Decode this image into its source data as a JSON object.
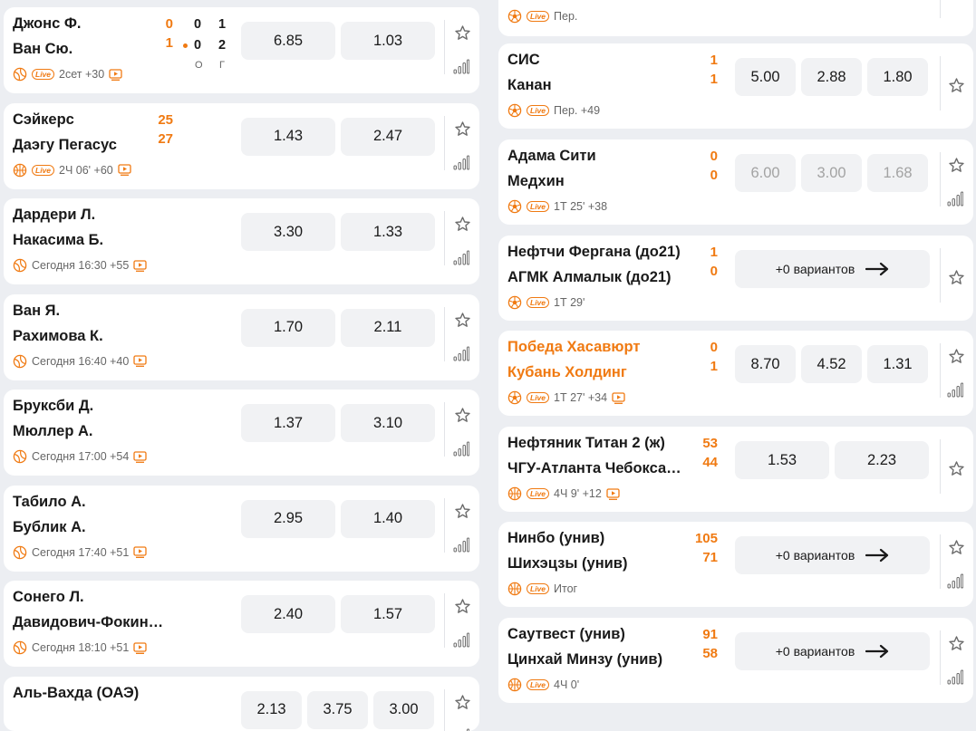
{
  "left_events": [
    {
      "team1": "Джонс Ф.",
      "team2": "Ван Сю.",
      "score1": "0",
      "score2": "1",
      "sport": "tennis",
      "live": "Live",
      "meta": "2сет +30",
      "tv": true,
      "set_scores": {
        "row1": [
          "0",
          "1"
        ],
        "row2": [
          "0",
          "2"
        ],
        "labels": [
          "О",
          "Г"
        ]
      },
      "odds": [
        "6.85",
        "1.03"
      ]
    },
    {
      "team1": "Сэйкерс",
      "team2": "Даэгу Пегасус",
      "score1": "25",
      "score2": "27",
      "sport": "basketball",
      "live": "Live",
      "meta": "2Ч 06' +60",
      "tv": true,
      "odds": [
        "1.43",
        "2.47"
      ]
    },
    {
      "team1": "Дардери Л.",
      "team2": "Накасима Б.",
      "sport": "tennis",
      "meta": "Сегодня 16:30 +55",
      "tv": true,
      "odds": [
        "3.30",
        "1.33"
      ]
    },
    {
      "team1": "Ван Я.",
      "team2": "Рахимова К.",
      "sport": "tennis",
      "meta": "Сегодня 16:40 +40",
      "tv": true,
      "odds": [
        "1.70",
        "2.11"
      ]
    },
    {
      "team1": "Бруксби Д.",
      "team2": "Мюллер А.",
      "sport": "tennis",
      "meta": "Сегодня 17:00 +54",
      "tv": true,
      "odds": [
        "1.37",
        "3.10"
      ]
    },
    {
      "team1": "Табило А.",
      "team2": "Бублик А.",
      "sport": "tennis",
      "meta": "Сегодня 17:40 +51",
      "tv": true,
      "odds": [
        "2.95",
        "1.40"
      ]
    },
    {
      "team1": "Сонего Л.",
      "team2": "Давидович-Фокина А.",
      "sport": "tennis",
      "meta": "Сегодня 18:10 +51",
      "tv": true,
      "odds": [
        "2.40",
        "1.57"
      ]
    },
    {
      "team1": "Аль-Вахда (ОАЭ)",
      "odds": [
        "2.13",
        "3.75",
        "3.00"
      ]
    }
  ],
  "right_events": [
    {
      "sport": "football",
      "live": "Live",
      "meta": "Пер."
    },
    {
      "team1": "СИС",
      "team2": "Канан",
      "score1": "1",
      "score2": "1",
      "sport": "football",
      "live": "Live",
      "meta": "Пер. +49",
      "odds": [
        "5.00",
        "2.88",
        "1.80"
      ]
    },
    {
      "team1": "Адама Сити",
      "team2": "Медхин",
      "score1": "0",
      "score2": "0",
      "sport": "football",
      "live": "Live",
      "meta": "1Т 25' +38",
      "odds": [
        "6.00",
        "3.00",
        "1.68"
      ],
      "dim": true
    },
    {
      "team1": "Нефтчи Фергана (до21)",
      "team2": "АГМК Алмалык (до21)",
      "score1": "1",
      "score2": "0",
      "sport": "football",
      "live": "Live",
      "meta": "1Т 29'",
      "more": "+0 вариантов"
    },
    {
      "team1": "Победа Хасавюрт",
      "team2": "Кубань Холдинг",
      "score1": "0",
      "score2": "1",
      "sport": "football",
      "live": "Live",
      "meta": "1Т 27' +34",
      "tv": true,
      "odds": [
        "8.70",
        "4.52",
        "1.31"
      ],
      "highlight": true
    },
    {
      "team1": "Нефтяник Титан 2 (ж)",
      "team2": "ЧГУ-Атланта Чебоксары (ж)",
      "score1": "53",
      "score2": "44",
      "sport": "basketball",
      "live": "Live",
      "meta": "4Ч 9' +12",
      "tv": true,
      "odds": [
        "1.53",
        "2.23"
      ]
    },
    {
      "team1": "Нинбо (унив)",
      "team2": "Шихэцзы (унив)",
      "score1": "105",
      "score2": "71",
      "sport": "basketball",
      "live": "Live",
      "meta": "Итог",
      "more": "+0 вариантов"
    },
    {
      "team1": "Саутвест (унив)",
      "team2": "Цинхай Минзу (унив)",
      "score1": "91",
      "score2": "58",
      "sport": "basketball",
      "live": "Live",
      "meta": "4Ч 0'",
      "more": "+0 вариантов"
    }
  ],
  "colors": {
    "accent": "#f07a12",
    "card": "#ffffff",
    "bg": "#eceef2",
    "odd_bg": "#f1f2f4"
  }
}
